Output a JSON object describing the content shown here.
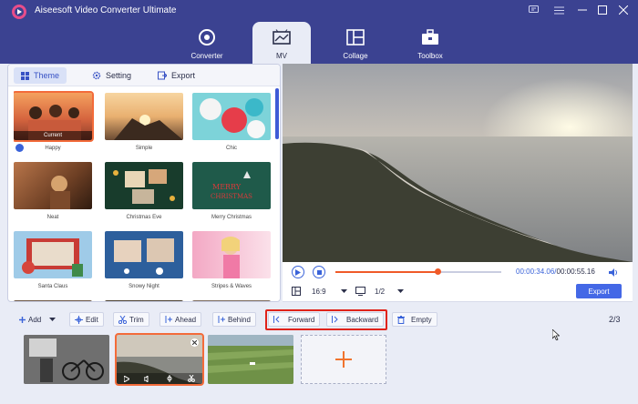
{
  "app": {
    "title": "Aiseesoft Video Converter Ultimate"
  },
  "nav": [
    {
      "label": "Converter",
      "icon": "converter-icon"
    },
    {
      "label": "MV",
      "icon": "mv-icon",
      "active": true
    },
    {
      "label": "Collage",
      "icon": "collage-icon"
    },
    {
      "label": "Toolbox",
      "icon": "toolbox-icon"
    }
  ],
  "panel": {
    "tabs": [
      {
        "label": "Theme",
        "icon": "grid-icon",
        "active": true
      },
      {
        "label": "Setting",
        "icon": "gear-icon"
      },
      {
        "label": "Export",
        "icon": "export-icon"
      }
    ],
    "themes": [
      {
        "label": "Happy",
        "selected": true,
        "badge": "Current"
      },
      {
        "label": "Simple"
      },
      {
        "label": "Chic"
      },
      {
        "label": "Neat"
      },
      {
        "label": "Christmas Eve"
      },
      {
        "label": "Merry Christmas"
      },
      {
        "label": "Santa Claus"
      },
      {
        "label": "Snowy Night"
      },
      {
        "label": "Stripes & Waves"
      }
    ]
  },
  "player": {
    "current_time": "00:00:34.06",
    "separator": "/",
    "total_time": "00:00:55.16",
    "progress": 0.62,
    "aspect_ratio": "16:9",
    "page": "1/2",
    "export_label": "Export"
  },
  "toolbar": {
    "add": "Add",
    "edit": "Edit",
    "trim": "Trim",
    "ahead": "Ahead",
    "behind": "Behind",
    "forward": "Forward",
    "backward": "Backward",
    "empty": "Empty",
    "count": "2/3"
  },
  "colors": {
    "header": "#3b4291",
    "accent": "#3a63d9",
    "progress": "#f05a28",
    "selection": "#f36b3a",
    "highlight": "#e0231a"
  }
}
